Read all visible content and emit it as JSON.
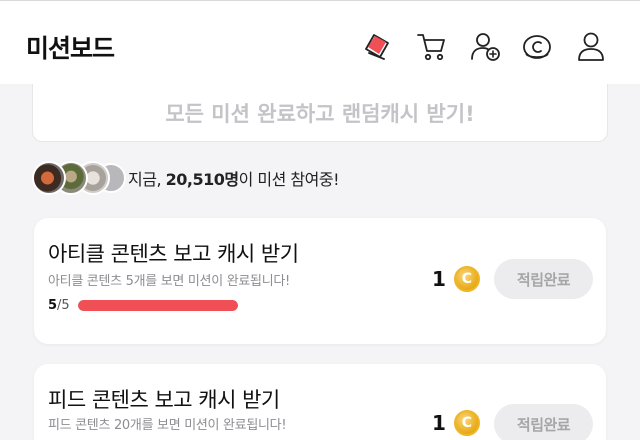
{
  "header": {
    "title": "미션보드",
    "icons": [
      "card-icon",
      "cart-icon",
      "add-friend-icon",
      "cash-icon",
      "profile-icon"
    ]
  },
  "banner": {
    "text": "모든 미션 완료하고 랜덤캐시 받기!"
  },
  "participants": {
    "prefix": "지금, ",
    "count": "20,510명",
    "suffix": "이 미션 참여중!"
  },
  "missions": [
    {
      "title": "아티클 콘텐츠 보고 캐시 받기",
      "description": "아티클 콘텐츠 5개를 보면 미션이 완료됩니다!",
      "progress_current": "5",
      "progress_total": "/5",
      "progress_fraction": 1.0,
      "reward": "1",
      "coin_symbol": "C",
      "status": "적립완료"
    },
    {
      "title": "피드 콘텐츠 보고 캐시 받기",
      "description": "피드 콘텐츠 20개를 보면 미션이 완료됩니다!",
      "reward": "1",
      "coin_symbol": "C",
      "status": "적립완료"
    }
  ],
  "colors": {
    "accent_red": "#ef4f55",
    "coin_gold": "#e8a916",
    "disabled_gray": "#a6a6aa"
  }
}
